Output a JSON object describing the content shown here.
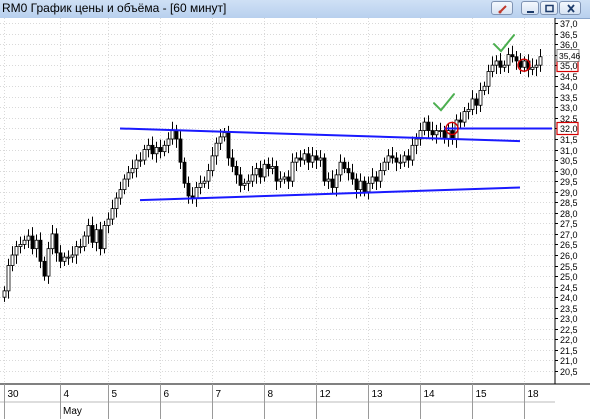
{
  "window": {
    "title": "RM0 График цены и объёма - [60 минут]",
    "tool_icon": "pencil-icon",
    "min_icon": "minimize-icon",
    "max_icon": "maximize-icon",
    "close_icon": "close-icon"
  },
  "chart_data": {
    "type": "candlestick",
    "title": "",
    "xlabel": "",
    "ylabel": "",
    "ylim": [
      20.5,
      37.0
    ],
    "y_ticks": [
      "37,0",
      "36,5",
      "36,0",
      "35,5",
      "35,0",
      "34,5",
      "34,0",
      "33,5",
      "33,0",
      "32,5",
      "32,0",
      "31,5",
      "31,0",
      "30,5",
      "30,0",
      "29,5",
      "29,0",
      "28,5",
      "28,0",
      "27,5",
      "27,0",
      "26,5",
      "26,0",
      "25,5",
      "25,0",
      "24,5",
      "24,0",
      "23,5",
      "23,0",
      "22,5",
      "22,0",
      "21,5",
      "21,0",
      "20,5"
    ],
    "x_days": [
      "30",
      "4",
      "5",
      "6",
      "7",
      "8",
      "12",
      "13",
      "14",
      "15",
      "18"
    ],
    "x_month": "May",
    "highlighted_levels": [
      {
        "label": "35,0",
        "value": 35.0
      },
      {
        "label": "32,0",
        "value": 32.0
      }
    ],
    "last_price_label": "35,46",
    "last_price": 35.46,
    "grid": true,
    "closes": [
      24.3,
      25.5,
      26.0,
      26.4,
      26.5,
      26.7,
      26.9,
      26.3,
      26.7,
      25.7,
      25.0,
      26.3,
      27.0,
      26.1,
      25.7,
      25.9,
      25.9,
      26.0,
      26.4,
      26.4,
      26.9,
      27.4,
      26.6,
      27.2,
      26.3,
      27.4,
      27.7,
      28.2,
      28.7,
      29.1,
      29.6,
      29.9,
      30.1,
      30.5,
      30.5,
      31.0,
      31.2,
      30.8,
      31.1,
      30.9,
      31.2,
      31.5,
      31.9,
      31.5,
      30.4,
      29.4,
      28.8,
      28.7,
      29.2,
      29.4,
      29.5,
      30.0,
      30.7,
      31.3,
      31.6,
      31.8,
      30.6,
      30.2,
      29.8,
      29.3,
      29.4,
      29.5,
      29.8,
      30.1,
      29.7,
      30.3,
      30.1,
      30.2,
      29.5,
      29.6,
      29.7,
      29.5,
      30.4,
      30.6,
      30.5,
      30.8,
      30.4,
      30.7,
      30.5,
      30.6,
      29.5,
      29.6,
      29.2,
      29.8,
      30.4,
      30.1,
      29.9,
      29.6,
      29.1,
      29.5,
      29.0,
      29.4,
      29.7,
      29.5,
      30.0,
      30.4,
      30.7,
      30.6,
      30.4,
      30.4,
      30.7,
      30.5,
      31.2,
      31.5,
      31.9,
      32.3,
      31.9,
      31.7,
      31.9,
      31.9,
      31.5,
      31.9,
      31.5,
      32.4,
      32.3,
      32.8,
      32.9,
      33.4,
      33.1,
      33.8,
      34.0,
      34.7,
      35.0,
      35.2,
      34.9,
      35.0,
      35.5,
      35.4,
      35.2,
      34.9,
      35.2,
      34.8,
      34.9,
      35.0,
      35.4
    ],
    "trendlines": [
      {
        "name": "resistance",
        "from": [
          29,
          32.0
        ],
        "to": [
          129,
          31.4
        ]
      },
      {
        "name": "support",
        "from": [
          34,
          28.6
        ],
        "to": [
          129,
          29.2
        ]
      },
      {
        "name": "level-32",
        "from": [
          110,
          32.0
        ],
        "to": [
          137,
          32.0
        ]
      }
    ],
    "circle_markers": [
      {
        "index": 112,
        "value": 32.0
      },
      {
        "index": 130,
        "value": 35.0
      }
    ],
    "check_markers": [
      {
        "index": 110,
        "value": 33.2
      },
      {
        "index": 125,
        "value": 36.0
      }
    ]
  }
}
